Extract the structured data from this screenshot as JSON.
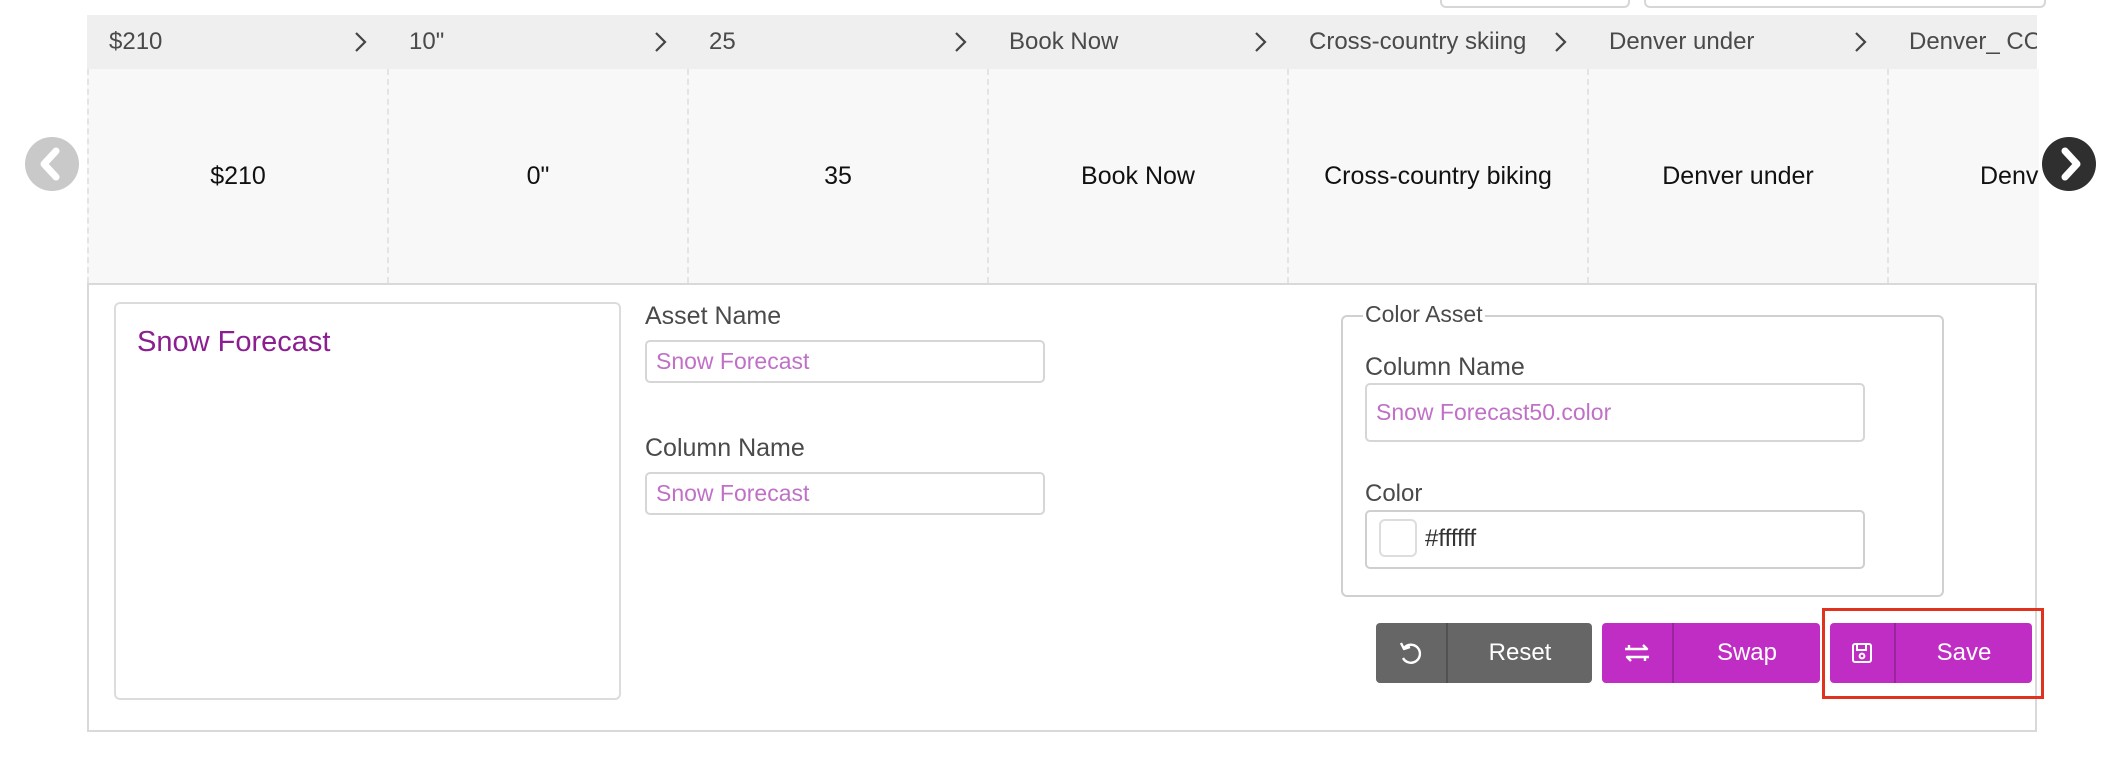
{
  "header_cells": [
    {
      "label": "$210"
    },
    {
      "label": "10\""
    },
    {
      "label": "25"
    },
    {
      "label": "Book Now"
    },
    {
      "label": "Cross-country skiing"
    },
    {
      "label": "Denver under"
    },
    {
      "label": "Denver_ CO"
    }
  ],
  "data_cells": [
    {
      "value": "$210"
    },
    {
      "value": "0\""
    },
    {
      "value": "35"
    },
    {
      "value": "Book Now"
    },
    {
      "value": "Cross-country biking"
    },
    {
      "value": "Denver under"
    },
    {
      "value": "Denver"
    }
  ],
  "preview": {
    "text": "Snow Forecast"
  },
  "asset_name": {
    "label": "Asset Name",
    "value": "Snow Forecast"
  },
  "column_name": {
    "label": "Column Name",
    "value": "Snow Forecast"
  },
  "color_asset": {
    "legend": "Color Asset",
    "column_name_label": "Column Name",
    "column_name_value": "Snow Forecast50.color",
    "color_label": "Color",
    "color_value": "#ffffff"
  },
  "buttons": {
    "reset": {
      "label": "Reset",
      "icon": "undo-icon"
    },
    "swap": {
      "label": "Swap",
      "icon": "swap-icon"
    },
    "save": {
      "label": "Save",
      "icon": "save-icon"
    }
  },
  "colors": {
    "accent": "#c02dc5",
    "preview_text": "#8b1f91",
    "reset_button": "#666666",
    "highlight": "#e0331f"
  }
}
